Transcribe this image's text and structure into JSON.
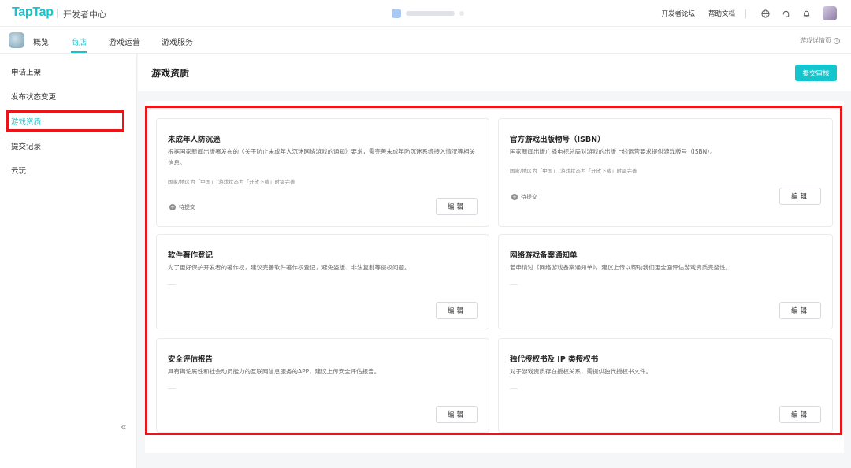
{
  "header": {
    "logo": "TapTap",
    "subtitle": "开发者中心",
    "links": [
      "开发者论坛",
      "帮助文档"
    ],
    "icons": [
      "globe-icon",
      "headset-icon",
      "bell-icon"
    ]
  },
  "subnav": {
    "tabs": [
      "概览",
      "商店",
      "游戏运营",
      "游戏服务"
    ],
    "active_tab": "商店",
    "detail_link": "游戏详情页"
  },
  "sidebar": {
    "items": [
      "申请上架",
      "发布状态变更",
      "游戏资质",
      "提交记录",
      "云玩"
    ],
    "active": "游戏资质",
    "collapse_glyph": "«"
  },
  "main": {
    "title": "游戏资质",
    "submit_label": "提交审核"
  },
  "cards": [
    {
      "title": "未成年人防沉迷",
      "desc": "根据国家新闻出版署发布的《关于防止未成年人沉迷网络游戏的通知》要求，需完善未成年防沉迷系统接入情况等相关信息。",
      "note": "国家/地区为「中国」、游戏状态为「开放下载」时需完善",
      "status": "待提交",
      "edit_label": "编辑"
    },
    {
      "title": "官方游戏出版物号（ISBN）",
      "desc": "国家新闻出版广播电视总局对游戏的出版上线运营要求提供游戏版号（ISBN）。",
      "note": "国家/地区为「中国」、游戏状态为「开放下载」时需完善",
      "status": "待提交",
      "edit_label": "编辑"
    },
    {
      "title": "软件著作登记",
      "desc": "为了更好保护开发者的著作权，建议完善软件著作权登记，避免盗版、非法复制等侵权问题。",
      "edit_label": "编辑"
    },
    {
      "title": "网络游戏备案通知单",
      "desc": "若申请过《网络游戏备案通知单》，建议上传以帮助我们更全面评估游戏资质完整性。",
      "edit_label": "编辑"
    },
    {
      "title": "安全评估报告",
      "desc": "具有舆论属性和社会动员能力的互联网信息服务的APP，建议上传安全评估报告。",
      "edit_label": "编辑"
    },
    {
      "title": "独代授权书及 IP 类授权书",
      "desc": "对于游戏资质存在授权关系，需提供独代授权书文件。",
      "edit_label": "编辑"
    }
  ],
  "colors": {
    "accent": "#15c5ce",
    "annotation": "#e8151b"
  }
}
